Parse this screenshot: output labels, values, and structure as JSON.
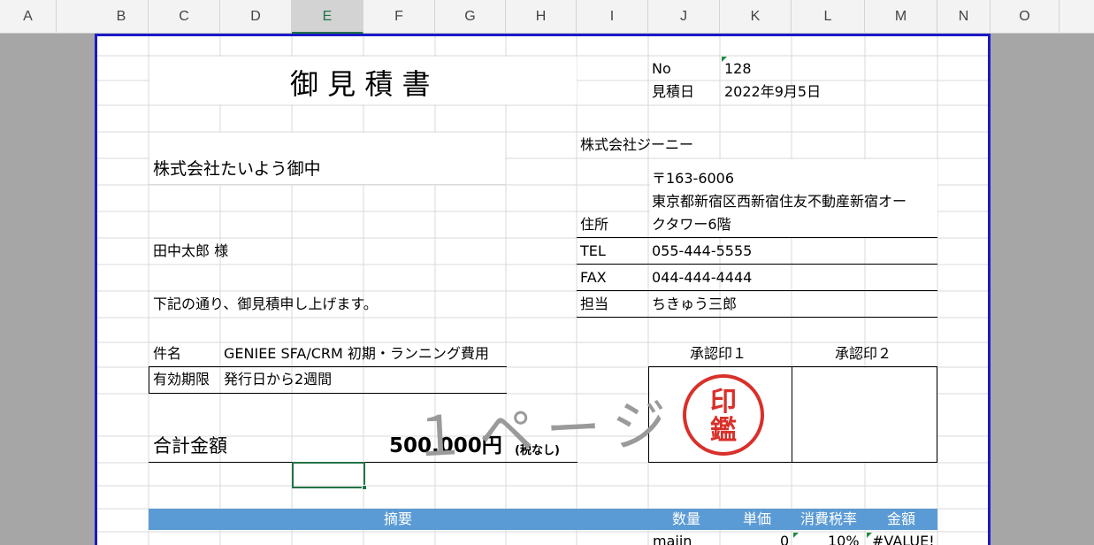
{
  "column_headers": [
    "A",
    "B",
    "C",
    "D",
    "E",
    "F",
    "G",
    "H",
    "I",
    "J",
    "K",
    "L",
    "M",
    "N",
    "O"
  ],
  "selected_column": "E",
  "doc": {
    "title": "御 見 積 書",
    "no_label": "No",
    "no_value": "128",
    "date_label": "見積日",
    "date_value": "2022年9月5日",
    "client_company": "株式会社たいよう御中",
    "client_person": "田中太郎 様",
    "intro": "下記の通り、御見積申し上げます。",
    "subject_label": "件名",
    "subject_value": "GENIEE SFA/CRM 初期・ランニング費用",
    "validity_label": "有効期限",
    "validity_value": "発行日から2週間",
    "total_label": "合計金額",
    "total_value": "500,000円",
    "tax_note": "(税なし)"
  },
  "issuer": {
    "company": "株式会社ジーニー",
    "postal": "〒163-6006",
    "address_line1": "東京都新宿区西新宿住友不動産新宿オー",
    "address_line2": "クタワー6階",
    "address_label": "住所",
    "tel_label": "TEL",
    "tel_value": "055-444-5555",
    "fax_label": "FAX",
    "fax_value": "044-444-4444",
    "rep_label": "担当",
    "rep_value": "ちきゅう三郎"
  },
  "approval": {
    "stamp1_label": "承認印１",
    "stamp2_label": "承認印２",
    "stamp_chars": [
      "印",
      "鑑"
    ]
  },
  "watermark": "１ページ",
  "table": {
    "headers": {
      "summary": "摘要",
      "qty": "数量",
      "unit_price": "単価",
      "tax_rate": "消費税率",
      "amount": "金額"
    },
    "row1": {
      "qty": "majin",
      "unit_price": "0",
      "tax_rate": "10%",
      "amount": "#VALUE!"
    }
  },
  "colors": {
    "header_bar": "#5b9bd5",
    "page_border": "#1a1ac8",
    "stamp": "#d9302a",
    "selection": "#217346"
  }
}
